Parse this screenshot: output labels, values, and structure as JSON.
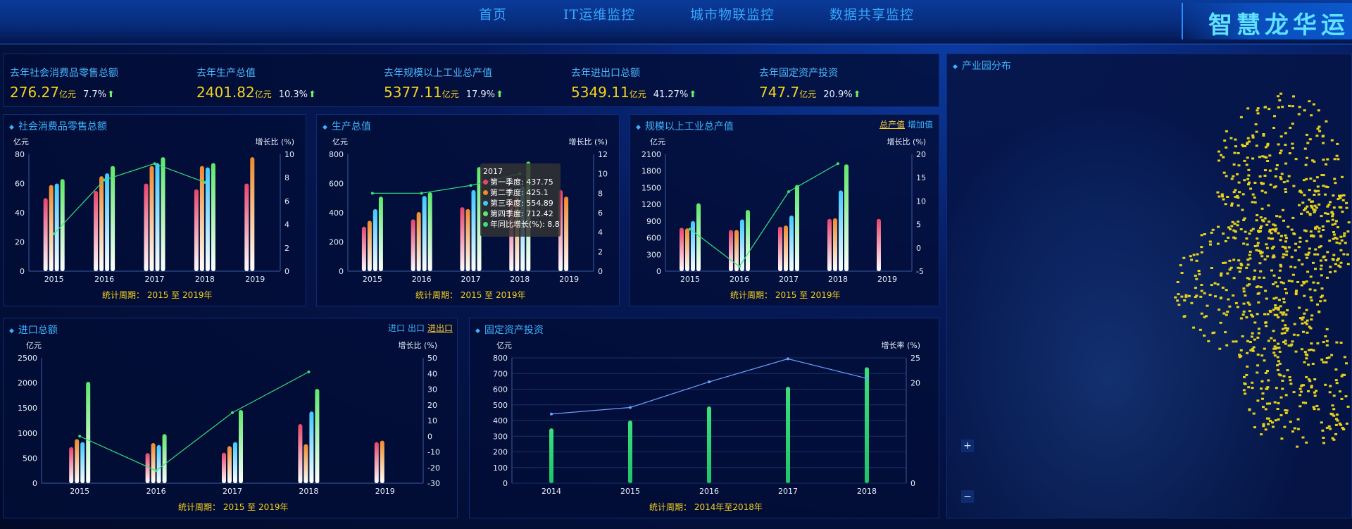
{
  "nav": {
    "items": [
      "首页",
      "IT运维监控",
      "城市物联监控",
      "数据共享监控"
    ],
    "brand": "智慧龙华运"
  },
  "kpis": [
    {
      "label": "去年社会消费品零售总额",
      "value": "276.27",
      "unit": "亿元",
      "pct": "7.7%"
    },
    {
      "label": "去年生产总值",
      "value": "2401.82",
      "unit": "亿元",
      "pct": "10.3%"
    },
    {
      "label": "去年规模以上工业总产值",
      "value": "5377.11",
      "unit": "亿元",
      "pct": "17.9%"
    },
    {
      "label": "去年进出口总额",
      "value": "5349.11",
      "unit": "亿元",
      "pct": "41.27%"
    },
    {
      "label": "去年固定资产投资",
      "value": "747.7",
      "unit": "亿元",
      "pct": "20.9%"
    }
  ],
  "park": {
    "title": "产业园分布",
    "zoom_in": "+",
    "zoom_out": "−"
  },
  "colors": {
    "q1": "#e8456b",
    "q2": "#ef8a2a",
    "q3": "#3fc8ff",
    "q4": "#5fe86a",
    "line": "#37e07a",
    "accent": "#f5d21b"
  },
  "toggles": {
    "industry": [
      {
        "label": "总产值",
        "active": true
      },
      {
        "label": "增加值",
        "active": false
      }
    ],
    "trade": [
      {
        "label": "进口",
        "active": false
      },
      {
        "label": "出口",
        "active": false
      },
      {
        "label": "进出口",
        "active": true
      }
    ]
  },
  "tooltip": {
    "title": "2017",
    "rows": [
      "第一季度: 437.75",
      "第二季度: 425.1",
      "第三季度: 554.89",
      "第四季度: 712.42",
      "年同比增长(%): 8.8"
    ]
  },
  "chart_data": [
    {
      "type": "bar",
      "title": "社会消费品零售总额",
      "ylabel": "亿元",
      "y2label": "增长比 (%)",
      "footer": "统计周期： 2015 至 2019年",
      "categories": [
        "2015",
        "2016",
        "2017",
        "2018",
        "2019"
      ],
      "ylim": [
        0,
        80
      ],
      "yticks": [
        "0",
        "20",
        "40",
        "60",
        "80"
      ],
      "y2lim": [
        0,
        10
      ],
      "y2ticks": [
        "0",
        "2",
        "4",
        "6",
        "8",
        "10"
      ],
      "series": [
        {
          "values": [
            50,
            55,
            60,
            56,
            60
          ]
        },
        {
          "values": [
            59,
            65,
            72,
            72,
            78
          ]
        },
        {
          "values": [
            60,
            67,
            74,
            71,
            null
          ]
        },
        {
          "values": [
            63,
            72,
            78,
            74,
            null
          ]
        }
      ],
      "line": {
        "values": [
          3.2,
          7.8,
          9.2,
          7.6,
          null
        ]
      }
    },
    {
      "type": "bar",
      "title": "生产总值",
      "ylabel": "亿元",
      "y2label": "增长比 (%)",
      "footer": "统计周期： 2015 至 2019年",
      "categories": [
        "2015",
        "2016",
        "2017",
        "2018",
        "2019"
      ],
      "ylim": [
        0,
        800
      ],
      "yticks": [
        "0",
        "200",
        "400",
        "600",
        "800"
      ],
      "y2lim": [
        0,
        12
      ],
      "y2ticks": [
        "0",
        "2",
        "4",
        "6",
        "8",
        "10",
        "12"
      ],
      "series": [
        {
          "values": [
            305,
            355,
            437.75,
            490,
            555
          ]
        },
        {
          "values": [
            345,
            405,
            425.1,
            510,
            510
          ]
        },
        {
          "values": [
            425,
            515,
            554.89,
            580,
            null
          ]
        },
        {
          "values": [
            510,
            540,
            712.42,
            750,
            null
          ]
        }
      ],
      "line": {
        "values": [
          8,
          8,
          8.8,
          10,
          null
        ]
      }
    },
    {
      "type": "bar",
      "title": "规模以上工业总产值",
      "ylabel": "亿元",
      "y2label": "增长比 (%)",
      "footer": "统计周期： 2015 至 2019年",
      "categories": [
        "2015",
        "2016",
        "2017",
        "2018",
        "2019"
      ],
      "ylim": [
        0,
        2100
      ],
      "yticks": [
        "0",
        "300",
        "600",
        "900",
        "1200",
        "1500",
        "1800",
        "2100"
      ],
      "y2lim": [
        -5,
        20
      ],
      "y2ticks": [
        "-5",
        "0",
        "5",
        "10",
        "15",
        "20"
      ],
      "series": [
        {
          "values": [
            780,
            740,
            800,
            940,
            940
          ]
        },
        {
          "values": [
            770,
            740,
            820,
            950,
            null
          ]
        },
        {
          "values": [
            900,
            930,
            1000,
            1450,
            null
          ]
        },
        {
          "values": [
            1220,
            1100,
            1550,
            1920,
            null
          ]
        }
      ],
      "line": {
        "values": [
          4,
          -4,
          12,
          18,
          null
        ]
      }
    },
    {
      "type": "bar",
      "title": "进口总额",
      "ylabel": "亿元",
      "y2label": "增长比 (%)",
      "footer": "统计周期： 2015 至 2019年",
      "categories": [
        "2015",
        "2016",
        "2017",
        "2018",
        "2019"
      ],
      "ylim": [
        0,
        2500
      ],
      "yticks": [
        "0",
        "500",
        "1000",
        "1500",
        "2000",
        "2500"
      ],
      "y2lim": [
        -30,
        50
      ],
      "y2ticks": [
        "-30",
        "-20",
        "-10",
        "0",
        "10",
        "20",
        "30",
        "40",
        "50"
      ],
      "series": [
        {
          "values": [
            720,
            600,
            610,
            1180,
            820
          ]
        },
        {
          "values": [
            880,
            800,
            740,
            780,
            850
          ]
        },
        {
          "values": [
            820,
            760,
            820,
            1430,
            null
          ]
        },
        {
          "values": [
            2020,
            980,
            1460,
            1880,
            null
          ]
        }
      ],
      "line": {
        "values": [
          0,
          -22,
          15,
          41,
          null
        ]
      }
    },
    {
      "type": "bar",
      "title": "固定资产投资",
      "ylabel": "亿元",
      "y2label": "增长率 (%)",
      "footer": "统计周期： 2014年至2018年",
      "categories": [
        "2014",
        "2015",
        "2016",
        "2017",
        "2018"
      ],
      "ylim": [
        0,
        800
      ],
      "yticks": [
        "0",
        "100",
        "200",
        "300",
        "400",
        "500",
        "600",
        "700",
        "800"
      ],
      "y2lim": [
        0,
        25
      ],
      "y2ticks": [
        "0",
        "20",
        "25"
      ],
      "series": [
        {
          "values": [
            350,
            400,
            490,
            615,
            740
          ]
        }
      ],
      "line": {
        "values": [
          13.8,
          15.1,
          20.2,
          24.8,
          20.9
        ]
      }
    }
  ]
}
